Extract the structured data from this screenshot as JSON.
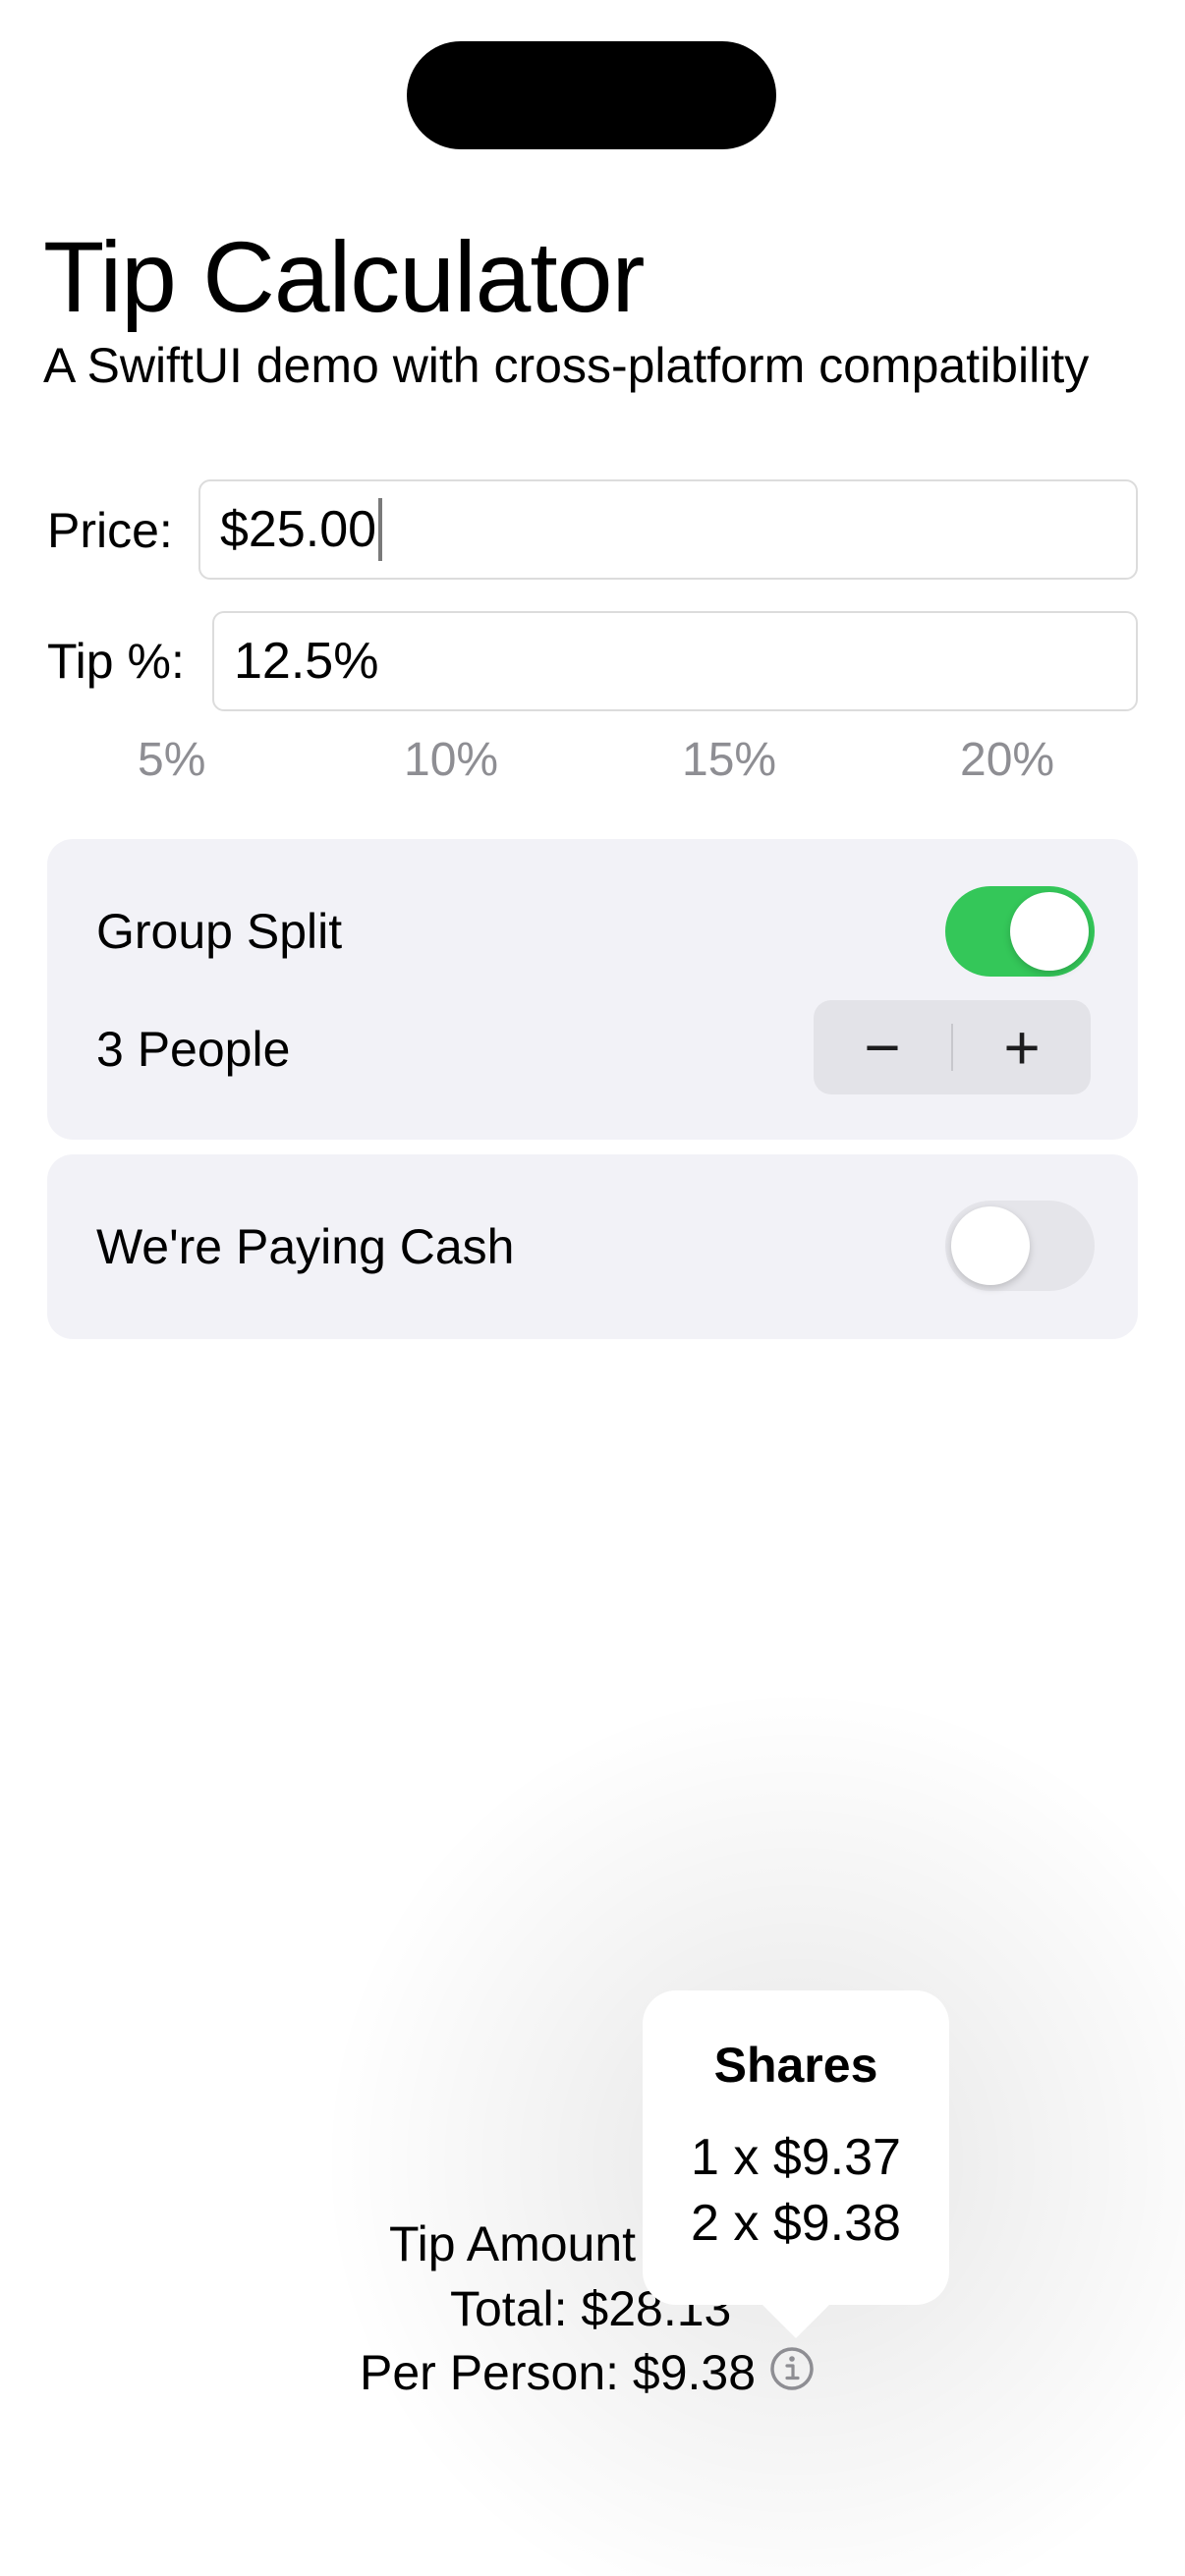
{
  "app": {
    "title": "Tip Calculator",
    "subtitle": "A SwiftUI demo with cross-platform compatibility"
  },
  "form": {
    "price_label": "Price:",
    "price_value": "$25.00",
    "tip_label": "Tip %:",
    "tip_value": "12.5%",
    "tip_presets": [
      "5%",
      "10%",
      "15%",
      "20%"
    ]
  },
  "group_split": {
    "label": "Group Split",
    "enabled": true,
    "people_label": "3 People",
    "decrement_symbol": "−",
    "increment_symbol": "+"
  },
  "cash": {
    "label": "We're Paying Cash",
    "enabled": false
  },
  "summary": {
    "tip_amount": "Tip Amount",
    "total": "Total: $28.13",
    "per_person": "Per Person: $9.38",
    "info_icon": "info-circle-icon"
  },
  "popover": {
    "title": "Shares",
    "lines": [
      "1 x $9.37",
      "2 x $9.38"
    ]
  },
  "colors": {
    "toggle_on": "#34c759",
    "card_background": "#f2f2f7",
    "secondary_text": "#8e8e93"
  }
}
